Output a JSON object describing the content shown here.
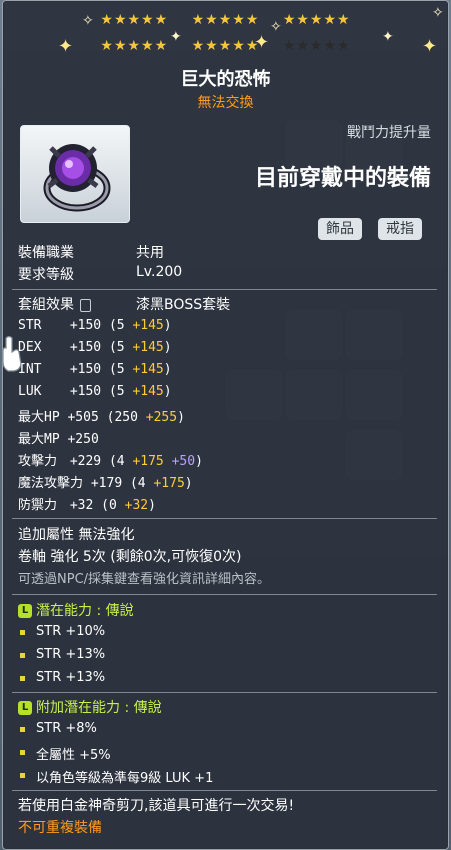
{
  "item": {
    "stars_row1": "★★★★★   ★★★★★   ★★★★★",
    "stars_row2": "★★★★★   ★★★★★",
    "name": "巨大的恐怖",
    "trade": "無法交換",
    "cp_label": "戰鬥力提升量",
    "wearing": "目前穿戴中的裝備",
    "tags": [
      "飾品",
      "戒指"
    ]
  },
  "info": {
    "job_label": "裝備職業",
    "job_value": "共用",
    "req_label": "要求等級",
    "req_value": "Lv.200",
    "set_label": "套組效果",
    "set_value": "漆黑BOSS套裝"
  },
  "stats": [
    {
      "name": "STR",
      "base": "+150",
      "paren_open": "(5",
      "add": "+145",
      "paren_close": ")"
    },
    {
      "name": "DEX",
      "base": "+150",
      "paren_open": "(5",
      "add": "+145",
      "paren_close": ")"
    },
    {
      "name": "INT",
      "base": "+150",
      "paren_open": "(5",
      "add": "+145",
      "paren_close": ")"
    },
    {
      "name": "LUK",
      "base": "+150",
      "paren_open": "(5",
      "add": "+145",
      "paren_close": ")"
    },
    {
      "name": "最大HP",
      "base": "+505",
      "paren_open": "(250",
      "add": "+255",
      "paren_close": ")"
    },
    {
      "name": "最大MP",
      "base": "+250"
    },
    {
      "name": "攻擊力",
      "base": "+229",
      "paren_open": "(4",
      "add": "+175",
      "add2": "+50",
      "paren_close": ")"
    },
    {
      "name": "魔法攻擊力",
      "base": "+179",
      "paren_open": "(4",
      "add": "+175",
      "paren_close": ")"
    },
    {
      "name": "防禦力",
      "base": "+32",
      "paren_open": "(0",
      "add": "+32",
      "paren_close": ")"
    }
  ],
  "extra": {
    "add_attr": "追加屬性 無法強化",
    "scroll": "卷軸 強化 5次 (剩餘0次,可恢復0次)",
    "hint": "可透過NPC/採集鍵查看強化資訊詳細內容。"
  },
  "potential": {
    "badge": "L",
    "title": "潛在能力 : 傳說",
    "lines": [
      "STR +10%",
      "STR +13%",
      "STR +13%"
    ]
  },
  "bonus_potential": {
    "badge": "L",
    "title": "附加潛在能力 : 傳說",
    "lines": [
      "STR +8%",
      "全屬性 +5%",
      "以角色等級為準每9級 LUK +1"
    ]
  },
  "footer": {
    "scissors": "若使用白金神奇剪刀,該道具可進行一次交易!",
    "unique": "不可重複裝備"
  },
  "colors": {
    "gold": "#ffcc33",
    "orange": "#ff9a1f",
    "legend_green": "#c6f04a",
    "bullet": "#e9d53a"
  }
}
